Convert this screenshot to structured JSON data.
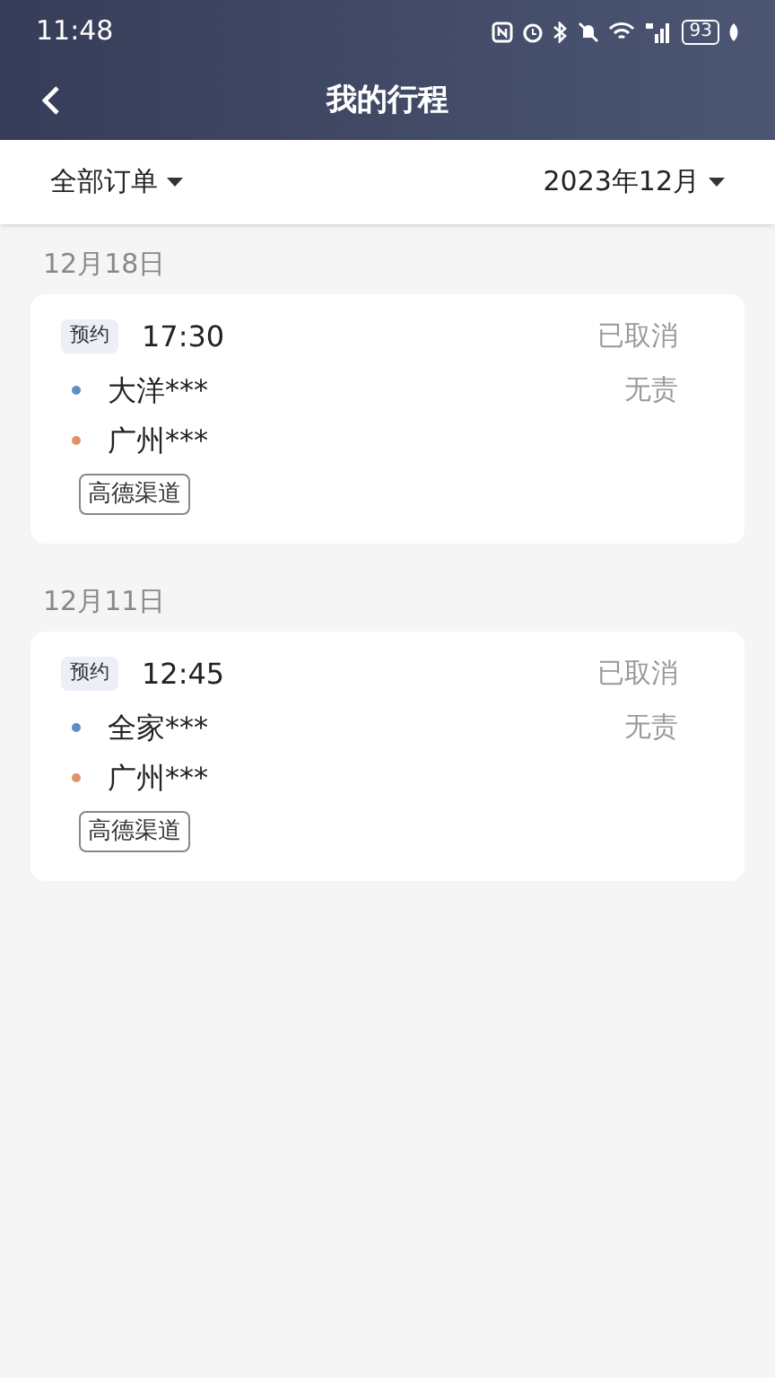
{
  "status_bar": {
    "time": "11:48",
    "battery": "93"
  },
  "header": {
    "title": "我的行程"
  },
  "filters": [
    {
      "label": "全部订单"
    },
    {
      "label": "2023年12月"
    }
  ],
  "trips": [
    {
      "date": "12月18日",
      "tag": "预约",
      "time": "17:30",
      "status": "已取消",
      "note": "无责",
      "stops": [
        {
          "name": "大洋***",
          "color": "#5b8fc7"
        },
        {
          "name": "广州***",
          "color": "#e0936a"
        }
      ],
      "channel": "高德渠道"
    },
    {
      "date": "12月11日",
      "tag": "预约",
      "time": "12:45",
      "status": "已取消",
      "note": "无责",
      "stops": [
        {
          "name": "全家***",
          "color": "#5b8fc7"
        },
        {
          "name": "广州***",
          "color": "#e0936a"
        }
      ],
      "channel": "高德渠道"
    }
  ]
}
